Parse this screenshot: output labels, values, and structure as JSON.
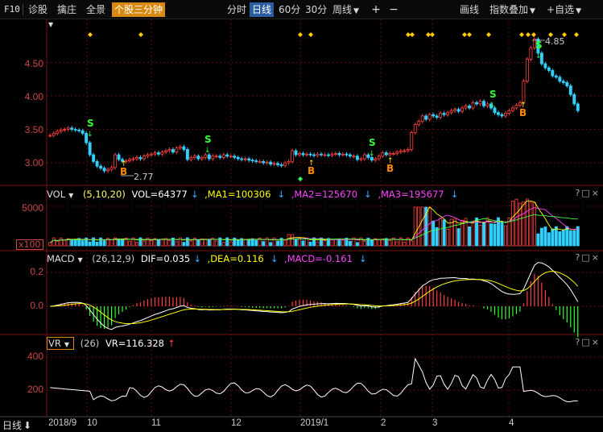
{
  "toolbar": {
    "f10": "F10",
    "diagnose": "诊股",
    "rub": "擒庄",
    "panorama": "全景",
    "three_min": "个股三分钟",
    "fen_shi": "分时",
    "daily": "日线",
    "min60": "60分",
    "min30": "30分",
    "weekly": "周线",
    "draw": "画线",
    "index_overlay": "指数叠加",
    "add_watch": "自选"
  },
  "price_panel": {
    "y_ticks": [
      "4.50",
      "4.00",
      "3.50",
      "3.00"
    ],
    "high_label": "4.85",
    "low_label": "2.77"
  },
  "vol_panel": {
    "name": "VOL",
    "params": "(5,10,20)",
    "vol": "VOL=64377",
    "ma1": "MA1=100306",
    "ma2": "MA2=125670",
    "ma3": "MA3=195677",
    "y_tick": "5000",
    "unit": "x100",
    "colors": {
      "ma1": "#ffff00",
      "ma2": "#ff44ff",
      "ma3": "#44ff44",
      "vol": "#ffffff"
    }
  },
  "macd_panel": {
    "name": "MACD",
    "params": "(26,12,9)",
    "dif": "DIF=0.035",
    "dea": "DEA=0.116",
    "macd": "MACD=-0.161",
    "y_ticks": [
      "0.2",
      "0.0"
    ],
    "colors": {
      "dif": "#ffffff",
      "dea": "#ffff00",
      "macd": "#ff44ff"
    }
  },
  "vr_panel": {
    "name": "VR",
    "params": "(26)",
    "vr": "VR=116.328",
    "y_ticks": [
      "400",
      "200"
    ]
  },
  "x_axis": {
    "period": "日线",
    "labels": [
      "2018/9",
      "10",
      "11",
      "12",
      "2019/1",
      "2",
      "3",
      "4"
    ]
  },
  "window_buttons": "?□×",
  "signals": {
    "buy": "B",
    "sell": "S"
  },
  "chart_data": {
    "type": "candlestick",
    "close": [
      3.41,
      3.44,
      3.47,
      3.49,
      3.5,
      3.52,
      3.5,
      3.49,
      3.48,
      3.44,
      3.3,
      3.12,
      3.02,
      2.95,
      2.92,
      2.88,
      2.9,
      2.93,
      3.12,
      3.05,
      3.02,
      3.03,
      3.05,
      3.06,
      3.08,
      3.06,
      3.1,
      3.12,
      3.13,
      3.15,
      3.13,
      3.16,
      3.18,
      3.2,
      3.16,
      3.22,
      3.24,
      3.2,
      3.05,
      3.08,
      3.1,
      3.06,
      3.08,
      3.12,
      3.06,
      3.1,
      3.1,
      3.08,
      3.12,
      3.1,
      3.1,
      3.08,
      3.06,
      3.05,
      3.06,
      3.04,
      3.03,
      3.02,
      3.02,
      3.0,
      3.01,
      2.98,
      2.99,
      2.97,
      2.96,
      3.0,
      3.02,
      3.18,
      3.12,
      3.14,
      3.12,
      3.13,
      3.12,
      3.11,
      3.13,
      3.12,
      3.12,
      3.11,
      3.13,
      3.14,
      3.12,
      3.13,
      3.12,
      3.1,
      3.1,
      3.05,
      3.06,
      3.12,
      3.08,
      3.04,
      3.06,
      3.1,
      3.15,
      3.12,
      3.14,
      3.14,
      3.16,
      3.18,
      3.18,
      3.2,
      3.45,
      3.57,
      3.62,
      3.7,
      3.65,
      3.72,
      3.7,
      3.68,
      3.74,
      3.72,
      3.75,
      3.78,
      3.8,
      3.77,
      3.82,
      3.85,
      3.82,
      3.9,
      3.88,
      3.92,
      3.85,
      3.88,
      3.82,
      3.75,
      3.72,
      3.7,
      3.74,
      3.78,
      3.82,
      3.86,
      3.9,
      4.22,
      4.55,
      4.72,
      4.85,
      4.64,
      4.48,
      4.42,
      4.38,
      4.3,
      4.28,
      4.22,
      4.2,
      4.15,
      4.02,
      3.88,
      3.78
    ]
  }
}
